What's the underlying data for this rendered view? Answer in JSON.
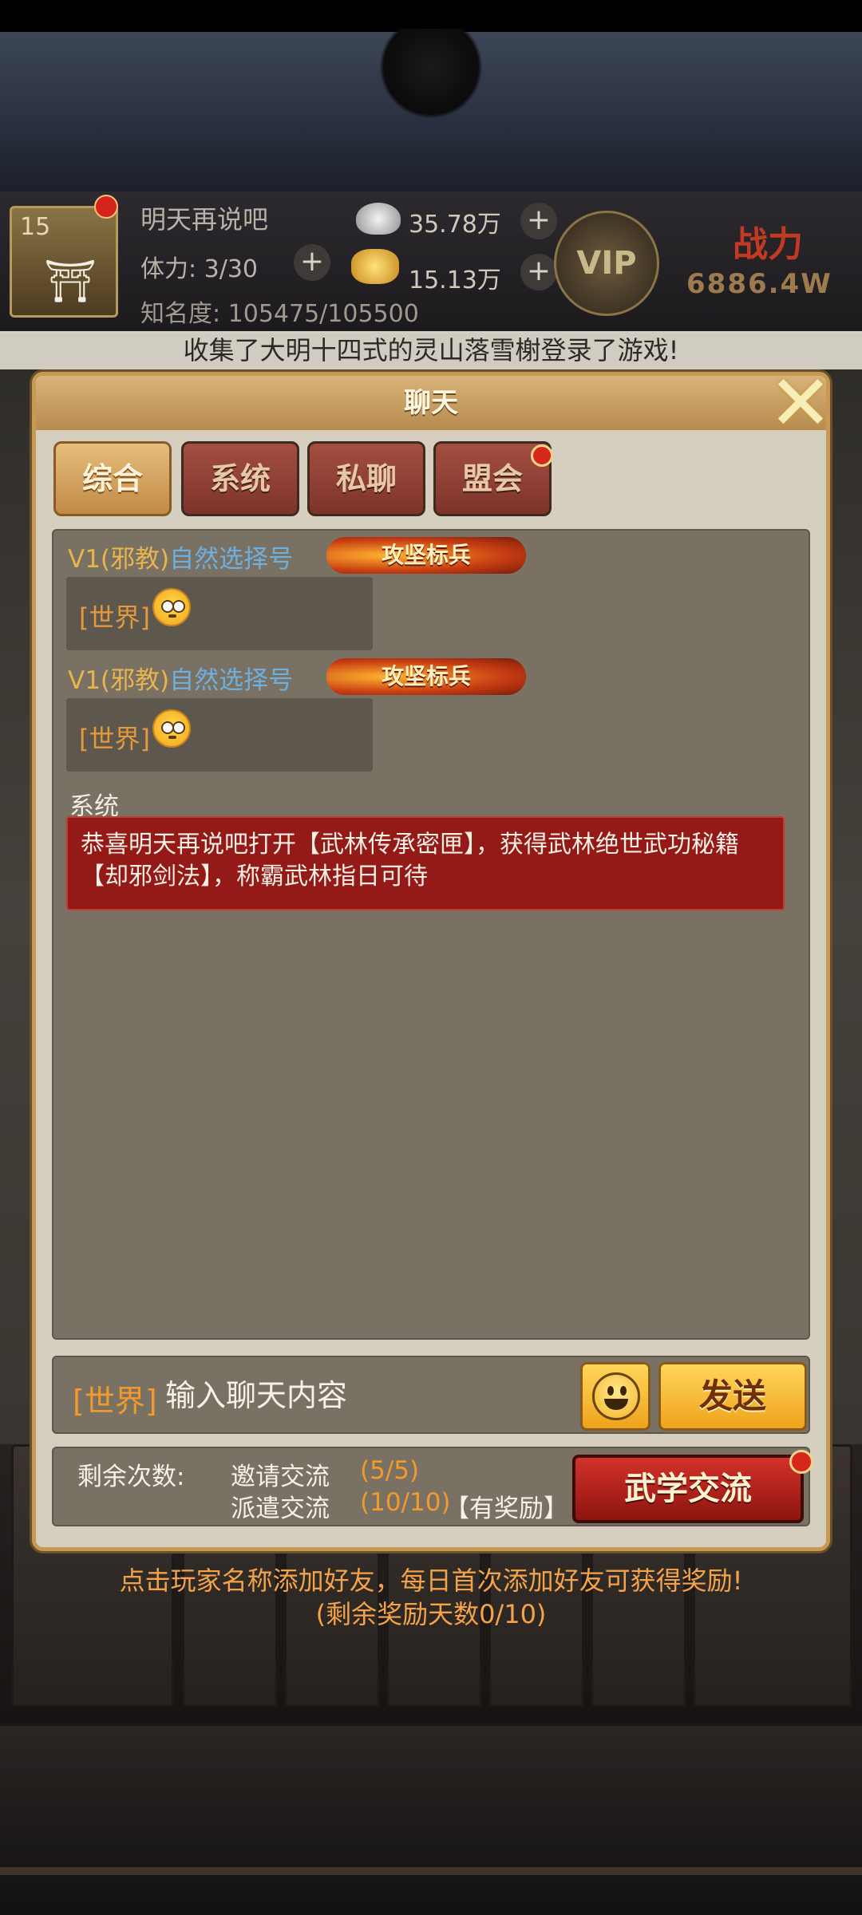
{
  "header": {
    "level": "15",
    "player_name": "明天再说吧",
    "stamina": "体力: 3/30",
    "fame": "知名度: 105475/105500",
    "silver": "35.78万",
    "gold": "15.13万",
    "vip_label": "VIP",
    "power_label": "战力",
    "power_value": "6886.4W"
  },
  "news": "收集了大明十四式的灵山落雪榭登录了游戏!",
  "chat": {
    "title": "聊天",
    "tabs": [
      "综合",
      "系统",
      "私聊",
      "盟会"
    ],
    "messages": [
      {
        "prefix": "V1(邪教)",
        "sender": "自然选择号",
        "badge": "攻坚标兵",
        "channel": "[世界]"
      },
      {
        "prefix": "V1(邪教)",
        "sender": "自然选择号",
        "badge": "攻坚标兵",
        "channel": "[世界]"
      }
    ],
    "system_label": "系统",
    "system_message": "恭喜明天再说吧打开【武林传承密匣】，获得武林绝世武功秘籍【却邪剑法】，称霸武林指日可待",
    "input_channel": "[世界]",
    "input_placeholder": "输入聊天内容",
    "send_label": "发送",
    "remaining_label": "剩余次数:",
    "invite_label": "邀请交流",
    "invite_count": "(5/5)",
    "dispatch_label": "派遣交流",
    "dispatch_count": "(10/10)",
    "reward_note": "【有奖励】",
    "martial_exchange_label": "武学交流"
  },
  "tips": {
    "line1": "点击玩家名称添加好友，每日首次添加好友可获得奖励!",
    "line2": "(剩余奖励天数0/10)"
  },
  "colors": {
    "accent_gold": "#c79a52",
    "system_red": "#941a17",
    "channel_orange": "#f39a2a",
    "user_blue": "#6db0e0"
  }
}
